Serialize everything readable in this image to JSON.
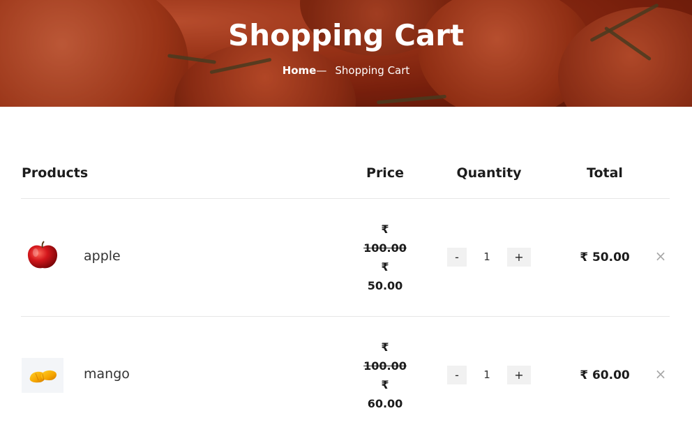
{
  "hero": {
    "title": "Shopping Cart",
    "breadcrumb": {
      "home": "Home",
      "separator": "—",
      "current": "Shopping Cart"
    }
  },
  "table": {
    "headers": {
      "products": "Products",
      "price": "Price",
      "quantity": "Quantity",
      "total": "Total"
    }
  },
  "cart": {
    "items": [
      {
        "name": "apple",
        "image": "apple-image",
        "currency": "₹",
        "old_price": "100.00",
        "price": "50.00",
        "quantity": "1",
        "minus_label": "-",
        "plus_label": "+",
        "total": "₹ 50.00",
        "remove_label": "×"
      },
      {
        "name": "mango",
        "image": "mango-image",
        "currency": "₹",
        "old_price": "100.00",
        "price": "60.00",
        "quantity": "1",
        "minus_label": "-",
        "plus_label": "+",
        "total": "₹ 60.00",
        "remove_label": "×"
      }
    ]
  },
  "colors": {
    "hero_base": "#8a2510",
    "text": "#1c1c1c",
    "button_bg": "#f1f1f1",
    "remove_icon": "#a8a8a8"
  }
}
